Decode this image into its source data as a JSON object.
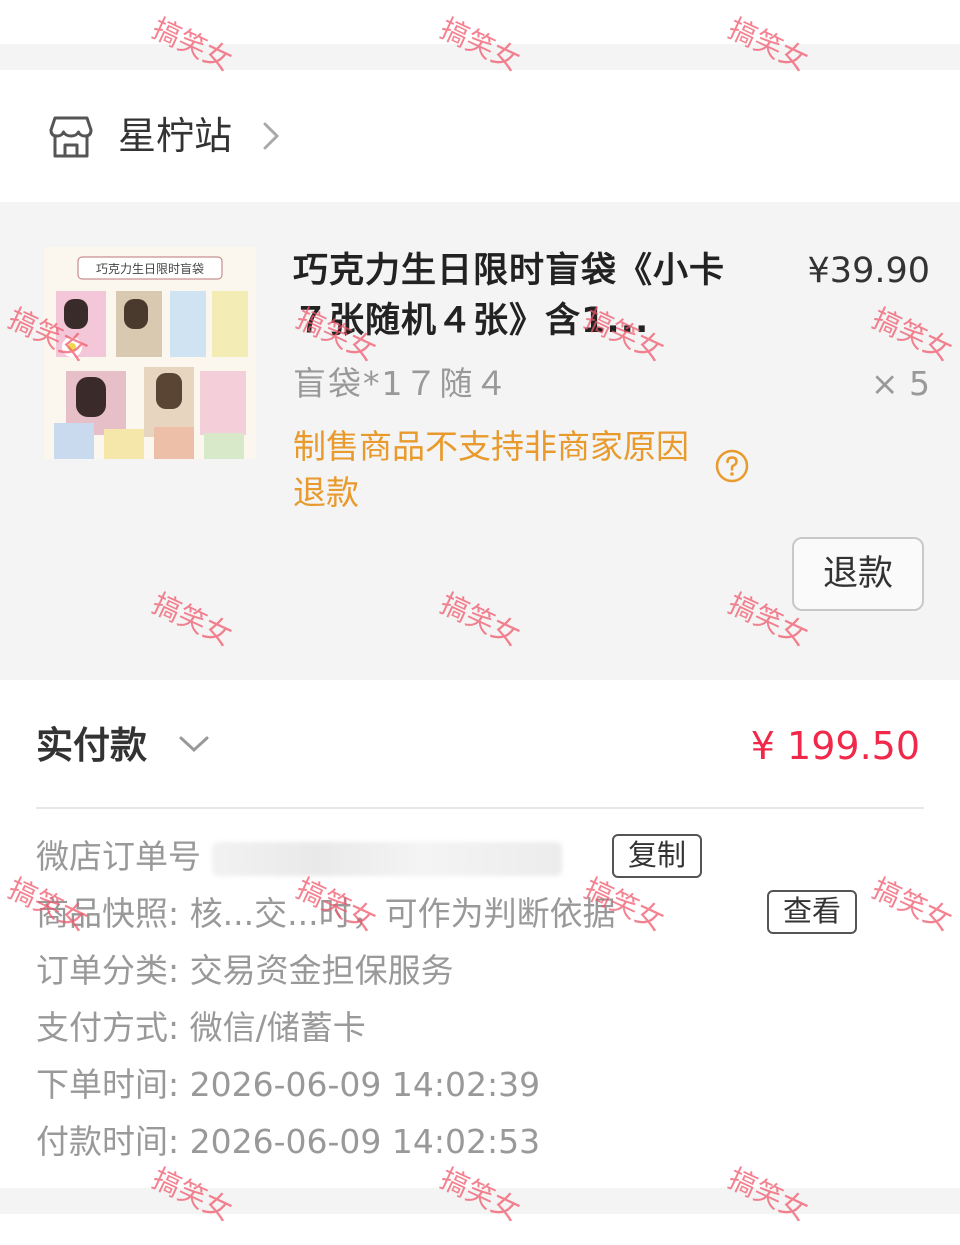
{
  "shop": {
    "name": "星柠站",
    "icon": "store-icon"
  },
  "product": {
    "title": "巧克力生日限时盲袋《小卡７张随机４张》含1...",
    "price": "¥39.90",
    "spec": "盲袋*1７随４",
    "quantity": "× 5",
    "notice": "制售商品不支持非商家原因退款",
    "refund_label": "退款",
    "thumbnail_banner": "巧克力生日限时盲袋"
  },
  "payment": {
    "label": "实付款",
    "amount": "¥ 199.50"
  },
  "details": {
    "order_no_label": "微店订单号",
    "copy_label": "复制",
    "snapshot_label": "商品快照:",
    "snapshot_value": "核...交...时，可作为判断依据",
    "view_label": "查看",
    "category_label": "订单分类:",
    "category_value": "交易资金担保服务",
    "pay_method_label": "支付方式:",
    "pay_method_value": "微信/储蓄卡",
    "order_time_label": "下单时间:",
    "order_time_value": "2026-06-09 14:02:39",
    "pay_time_label": "付款时间:",
    "pay_time_value": "2026-06-09 14:02:53"
  },
  "watermark": "搞笑女",
  "colors": {
    "accent": "#f0284a",
    "notice": "#e89a2c",
    "muted": "#999999"
  }
}
